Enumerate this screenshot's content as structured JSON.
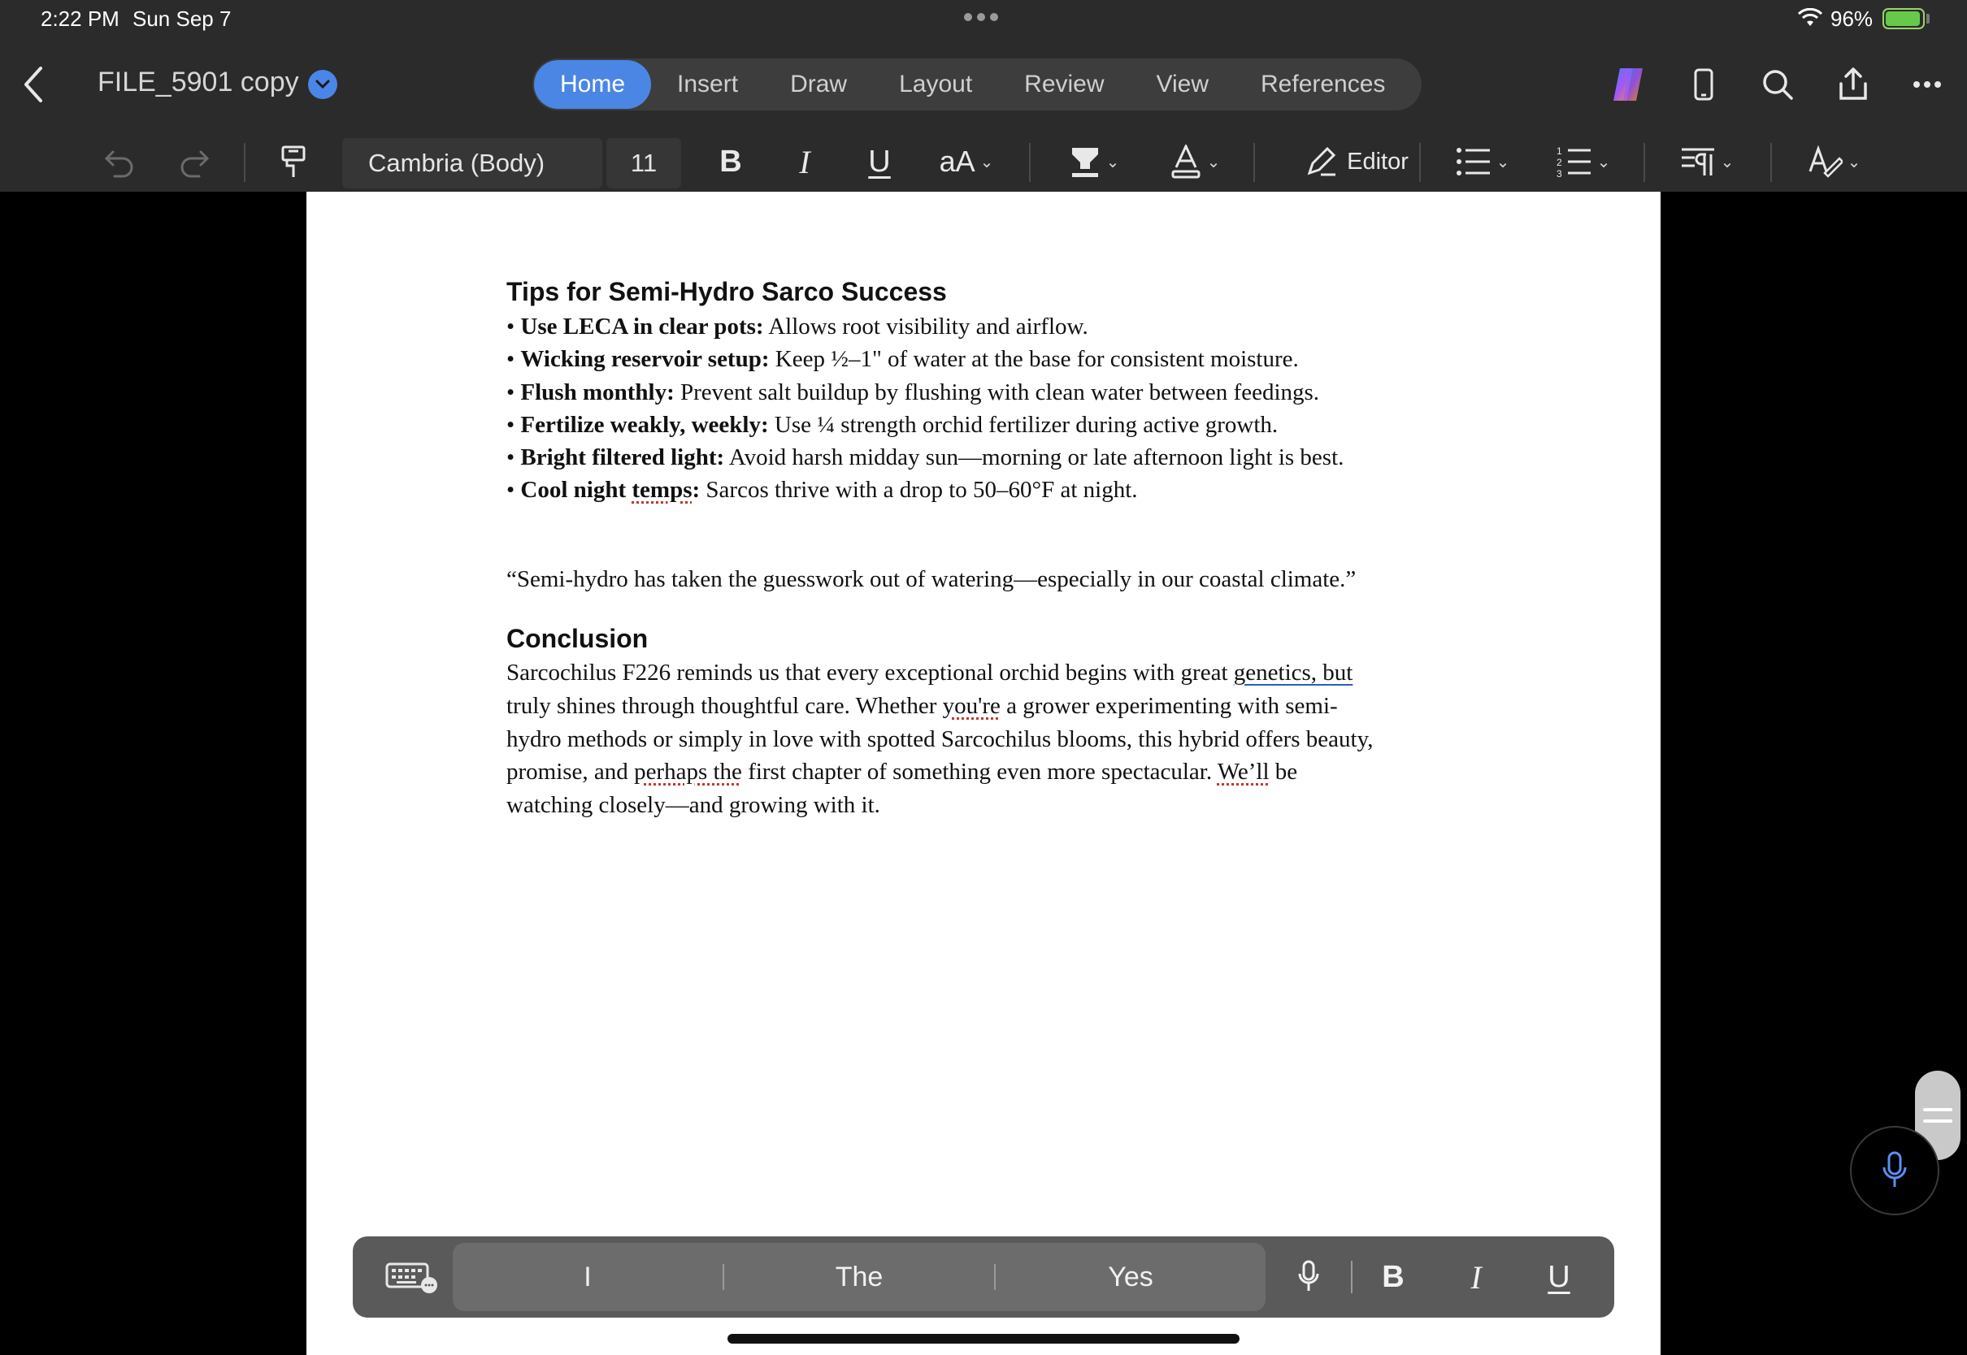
{
  "status_bar": {
    "time": "2:22 PM",
    "date": "Sun Sep 7",
    "battery_pct": "96%",
    "battery_level": 0.96
  },
  "document": {
    "title": "FILE_5901 copy"
  },
  "tabs": [
    "Home",
    "Insert",
    "Draw",
    "Layout",
    "Review",
    "View",
    "References"
  ],
  "active_tab": "Home",
  "ribbon": {
    "font_name": "Cambria (Body)",
    "font_size": "11",
    "editor_label": "Editor",
    "font_size_glyph": "aA",
    "bold_glyph": "B",
    "italic_glyph": "I",
    "underline_glyph": "U"
  },
  "content": {
    "heading1": "Tips for Semi-Hydro Sarco Success",
    "bullet": "•",
    "tips": [
      {
        "bold": "Use LECA in clear pots:",
        "text": " Allows root visibility and airflow."
      },
      {
        "bold": "Wicking reservoir setup:",
        "text": " Keep ½–1\" of water at the base for consistent moisture."
      },
      {
        "bold": "Flush monthly:",
        "text": " Prevent salt buildup by flushing with clean water between feedings."
      },
      {
        "bold": "Fertilize weakly, weekly:",
        "text": " Use ¼ strength orchid fertilizer during active growth."
      },
      {
        "bold": "Bright filtered light:",
        "text": " Avoid harsh midday sun—morning or late afternoon light is best."
      },
      {
        "bold_pre": "Cool night ",
        "bold_squig": "temps",
        "bold_post": ":",
        "text": " Sarcos thrive with a drop to 50–60°F at night."
      }
    ],
    "quote": "“Semi-hydro has taken the guesswork out of watering—especially in our coastal climate.”",
    "heading2": "Conclusion",
    "conclusion": {
      "l1_pre": "Sarcochilus F226 reminds us that every exceptional orchid begins with great ",
      "l1_blue": "genetics, but",
      "l2_pre": "truly shines through thoughtful care. Whether ",
      "l2_squig": "you're",
      "l2_post": " a grower experimenting with semi-",
      "l3": "hydro methods or simply in love with spotted Sarcochilus blooms, this hybrid offers beauty,",
      "l4_pre": "promise, and ",
      "l4_squig": "perhaps the",
      "l4_mid": " first chapter of something even more spectacular. ",
      "l4_squig2": "We’ll",
      "l4_post": " be",
      "l5": "watching closely—and growing with it."
    }
  },
  "shortcut_bar": {
    "predictions": [
      "I",
      "The",
      "Yes"
    ],
    "bold": "B",
    "italic": "I",
    "underline": "U"
  },
  "icons": {
    "back": "chevron-left-icon",
    "copilot": "copilot-icon",
    "device": "phone-icon",
    "search": "search-icon",
    "share": "share-icon",
    "more": "more-icon"
  },
  "colors": {
    "accent": "#4b86e4",
    "toolbar_bg": "#2b2b2b",
    "page_bg": "#ffffff"
  }
}
